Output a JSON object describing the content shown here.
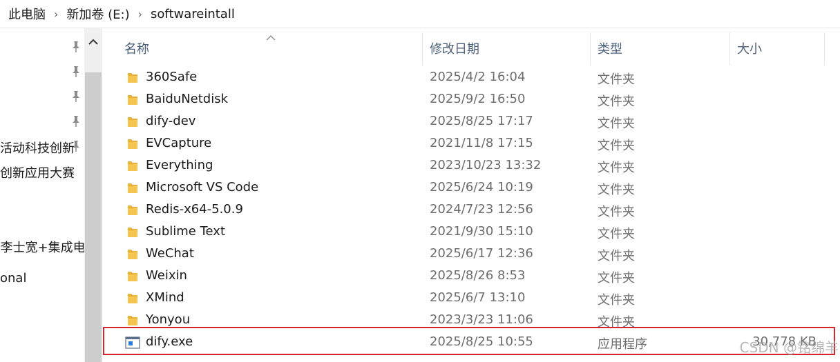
{
  "breadcrumb": {
    "items": [
      "此电脑",
      "新加卷 (E:)",
      "softwareintall"
    ]
  },
  "nav": {
    "items": [
      {
        "label": "",
        "pinned": true
      },
      {
        "label": "",
        "pinned": true
      },
      {
        "label": "",
        "pinned": true
      },
      {
        "label": "",
        "pinned": true
      },
      {
        "label": "活动科技创新",
        "pinned": true
      },
      {
        "label": "创新应用大赛",
        "pinned": false
      },
      {
        "label": "",
        "pinned": false
      },
      {
        "label": "-李士宽+集成电",
        "pinned": false
      },
      {
        "label": "onal",
        "pinned": false
      }
    ]
  },
  "columns": {
    "name": "名称",
    "date": "修改日期",
    "type": "类型",
    "size": "大小"
  },
  "files": [
    {
      "name": "360Safe",
      "date": "2025/4/2 16:04",
      "type": "文件夹",
      "size": "",
      "icon": "folder-icon"
    },
    {
      "name": "BaiduNetdisk",
      "date": "2025/9/2 16:50",
      "type": "文件夹",
      "size": "",
      "icon": "folder-icon"
    },
    {
      "name": "dify-dev",
      "date": "2025/8/25 17:17",
      "type": "文件夹",
      "size": "",
      "icon": "folder-icon"
    },
    {
      "name": "EVCapture",
      "date": "2021/11/8 17:15",
      "type": "文件夹",
      "size": "",
      "icon": "folder-icon"
    },
    {
      "name": "Everything",
      "date": "2023/10/23 13:32",
      "type": "文件夹",
      "size": "",
      "icon": "folder-icon"
    },
    {
      "name": "Microsoft VS Code",
      "date": "2025/6/24 10:19",
      "type": "文件夹",
      "size": "",
      "icon": "folder-icon"
    },
    {
      "name": "Redis-x64-5.0.9",
      "date": "2024/7/23 12:56",
      "type": "文件夹",
      "size": "",
      "icon": "folder-icon"
    },
    {
      "name": "Sublime Text",
      "date": "2021/9/30 15:10",
      "type": "文件夹",
      "size": "",
      "icon": "folder-icon"
    },
    {
      "name": "WeChat",
      "date": "2025/6/17 12:36",
      "type": "文件夹",
      "size": "",
      "icon": "folder-icon"
    },
    {
      "name": "Weixin",
      "date": "2025/8/26 8:53",
      "type": "文件夹",
      "size": "",
      "icon": "folder-icon"
    },
    {
      "name": "XMind",
      "date": "2025/6/7 13:10",
      "type": "文件夹",
      "size": "",
      "icon": "folder-icon"
    },
    {
      "name": "Yonyou",
      "date": "2023/3/23 11:06",
      "type": "文件夹",
      "size": "",
      "icon": "folder-icon"
    },
    {
      "name": "dify.exe",
      "date": "2025/8/25 10:55",
      "type": "应用程序",
      "size": "30,778 KB",
      "icon": "exe-icon"
    }
  ],
  "watermark": "CSDN @铭绵羊",
  "colors": {
    "highlight": "#d9222a",
    "folder": "#f4c44e",
    "header_text": "#4c607a"
  }
}
